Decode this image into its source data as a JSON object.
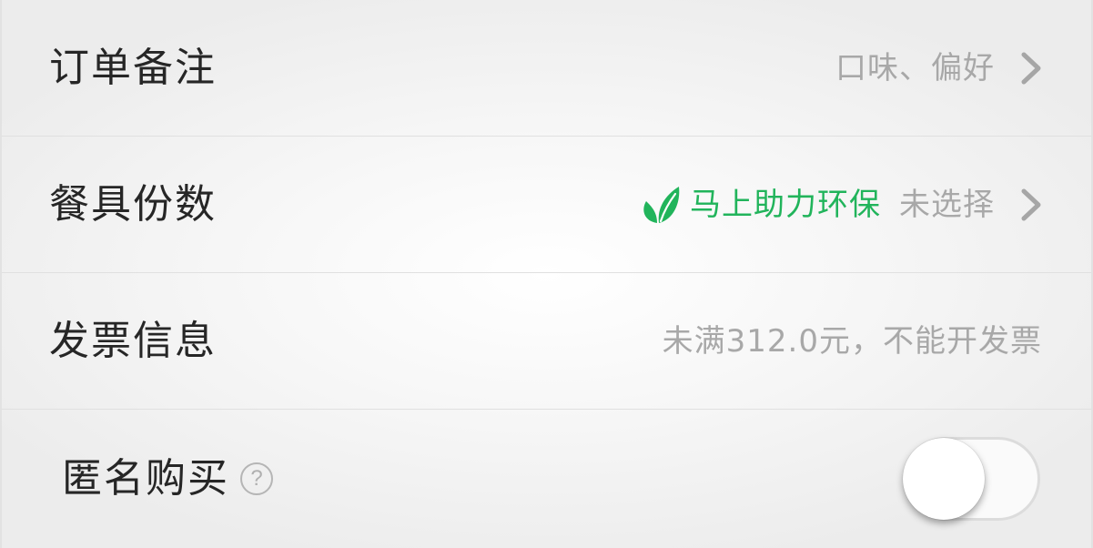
{
  "rows": {
    "order_note": {
      "label": "订单备注",
      "hint": "口味、偏好"
    },
    "tableware": {
      "label": "餐具份数",
      "eco_text": "马上助力环保",
      "hint": "未选择"
    },
    "invoice": {
      "label": "发票信息",
      "hint": "未满312.0元，不能开发票"
    },
    "anonymous": {
      "label": "匿名购买",
      "help_glyph": "?",
      "toggle_on": false
    }
  },
  "colors": {
    "label": "#262626",
    "hint": "#a8a8a8",
    "eco": "#21b45b",
    "divider": "#e0e0e0"
  },
  "icons": {
    "chevron": "chevron-right-icon",
    "leaf": "leaf-icon",
    "help": "question-circle-icon"
  }
}
